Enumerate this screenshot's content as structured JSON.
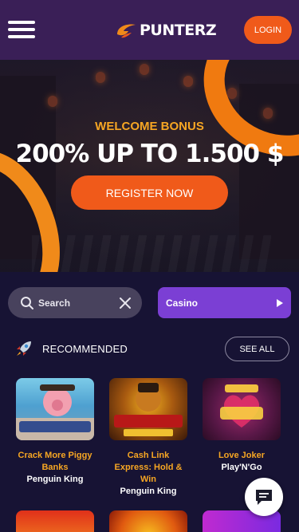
{
  "header": {
    "logo_text": "PUNTERZ",
    "login_label": "LOGIN"
  },
  "hero": {
    "subtitle": "WELCOME BONUS",
    "title": "200% UP TO 1.500 $",
    "register_label": "REGISTER NOW"
  },
  "search": {
    "placeholder": "Search",
    "category": "Casino"
  },
  "recommended": {
    "title": "RECOMMENDED",
    "see_all_label": "SEE ALL",
    "games": [
      {
        "name": "Crack More Piggy Banks",
        "provider": "Penguin King"
      },
      {
        "name": "Cash Link Express: Hold & Win",
        "provider": "Penguin King"
      },
      {
        "name": "Love Joker",
        "provider": "Play'N'Go"
      }
    ],
    "thumb_texts": [
      "CRACK MORE PIGGY BANKS",
      "CASH LINK EXPRESS HOLD & WIN",
      "Love Joker"
    ]
  },
  "colors": {
    "header_bg": "#3a1f57",
    "accent_orange": "#f05a1a",
    "gold_text": "#f6a623",
    "category_purple": "#7b3fd4",
    "page_bg": "#171334"
  },
  "icons": [
    "menu-icon",
    "search-icon",
    "close-icon",
    "play-icon",
    "rocket-icon",
    "chat-icon"
  ]
}
